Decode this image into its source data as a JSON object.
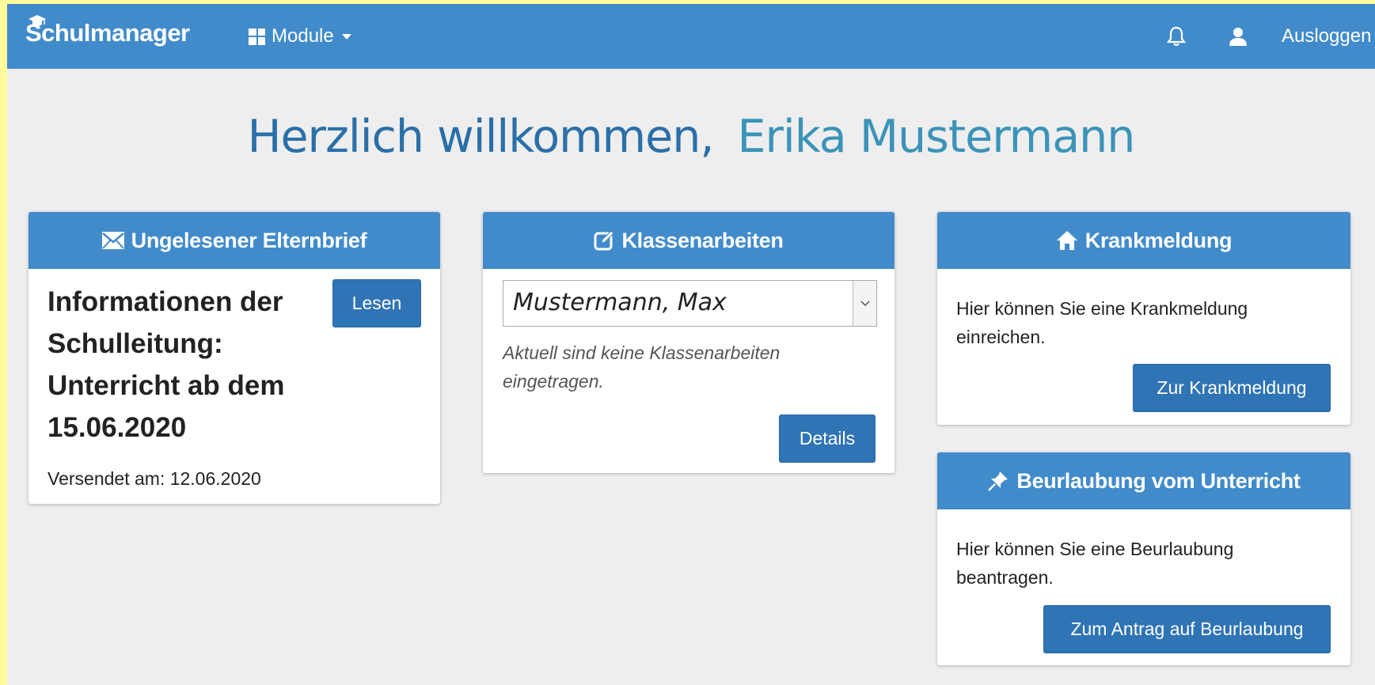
{
  "app": {
    "brand": "Schulmanager",
    "modules_label": "Module",
    "logout_label": "Ausloggen"
  },
  "welcome": {
    "greeting": "Herzlich willkommen,",
    "name": "Erika Mustermann"
  },
  "elternbrief": {
    "title": "Ungelesener Elternbrief",
    "message": "Informationen der Schulleitung: Unterricht ab dem 15.06.2020",
    "button": "Lesen",
    "sent": "Versendet am: 12.06.2020"
  },
  "klassenarbeiten": {
    "title": "Klassenarbeiten",
    "selected_student": "Mustermann, Max",
    "note": "Aktuell sind keine Klassenarbeiten eingetragen.",
    "button": "Details"
  },
  "krankmeldung": {
    "title": "Krankmeldung",
    "text": "Hier können Sie eine Krankmeldung einreichen.",
    "button": "Zur Krankmeldung"
  },
  "beurlaubung": {
    "title": "Beurlaubung vom Unterricht",
    "text": "Hier können Sie eine Beurlaubung beantragen.",
    "button": "Zum Antrag auf Beurlaubung"
  },
  "colors": {
    "primary": "#418bcb",
    "button": "#2f74b5",
    "background": "#eeeeee",
    "welcome_text": "#2a6fa8",
    "welcome_name": "#3b93b8"
  },
  "icons": {
    "brand": "graduation-cap-icon",
    "modules": "grid-icon",
    "notifications": "bell-icon",
    "profile": "user-icon",
    "elternbrief": "envelope-icon",
    "klassenarbeiten": "edit-icon",
    "krankmeldung": "home-icon",
    "beurlaubung": "pushpin-icon"
  }
}
